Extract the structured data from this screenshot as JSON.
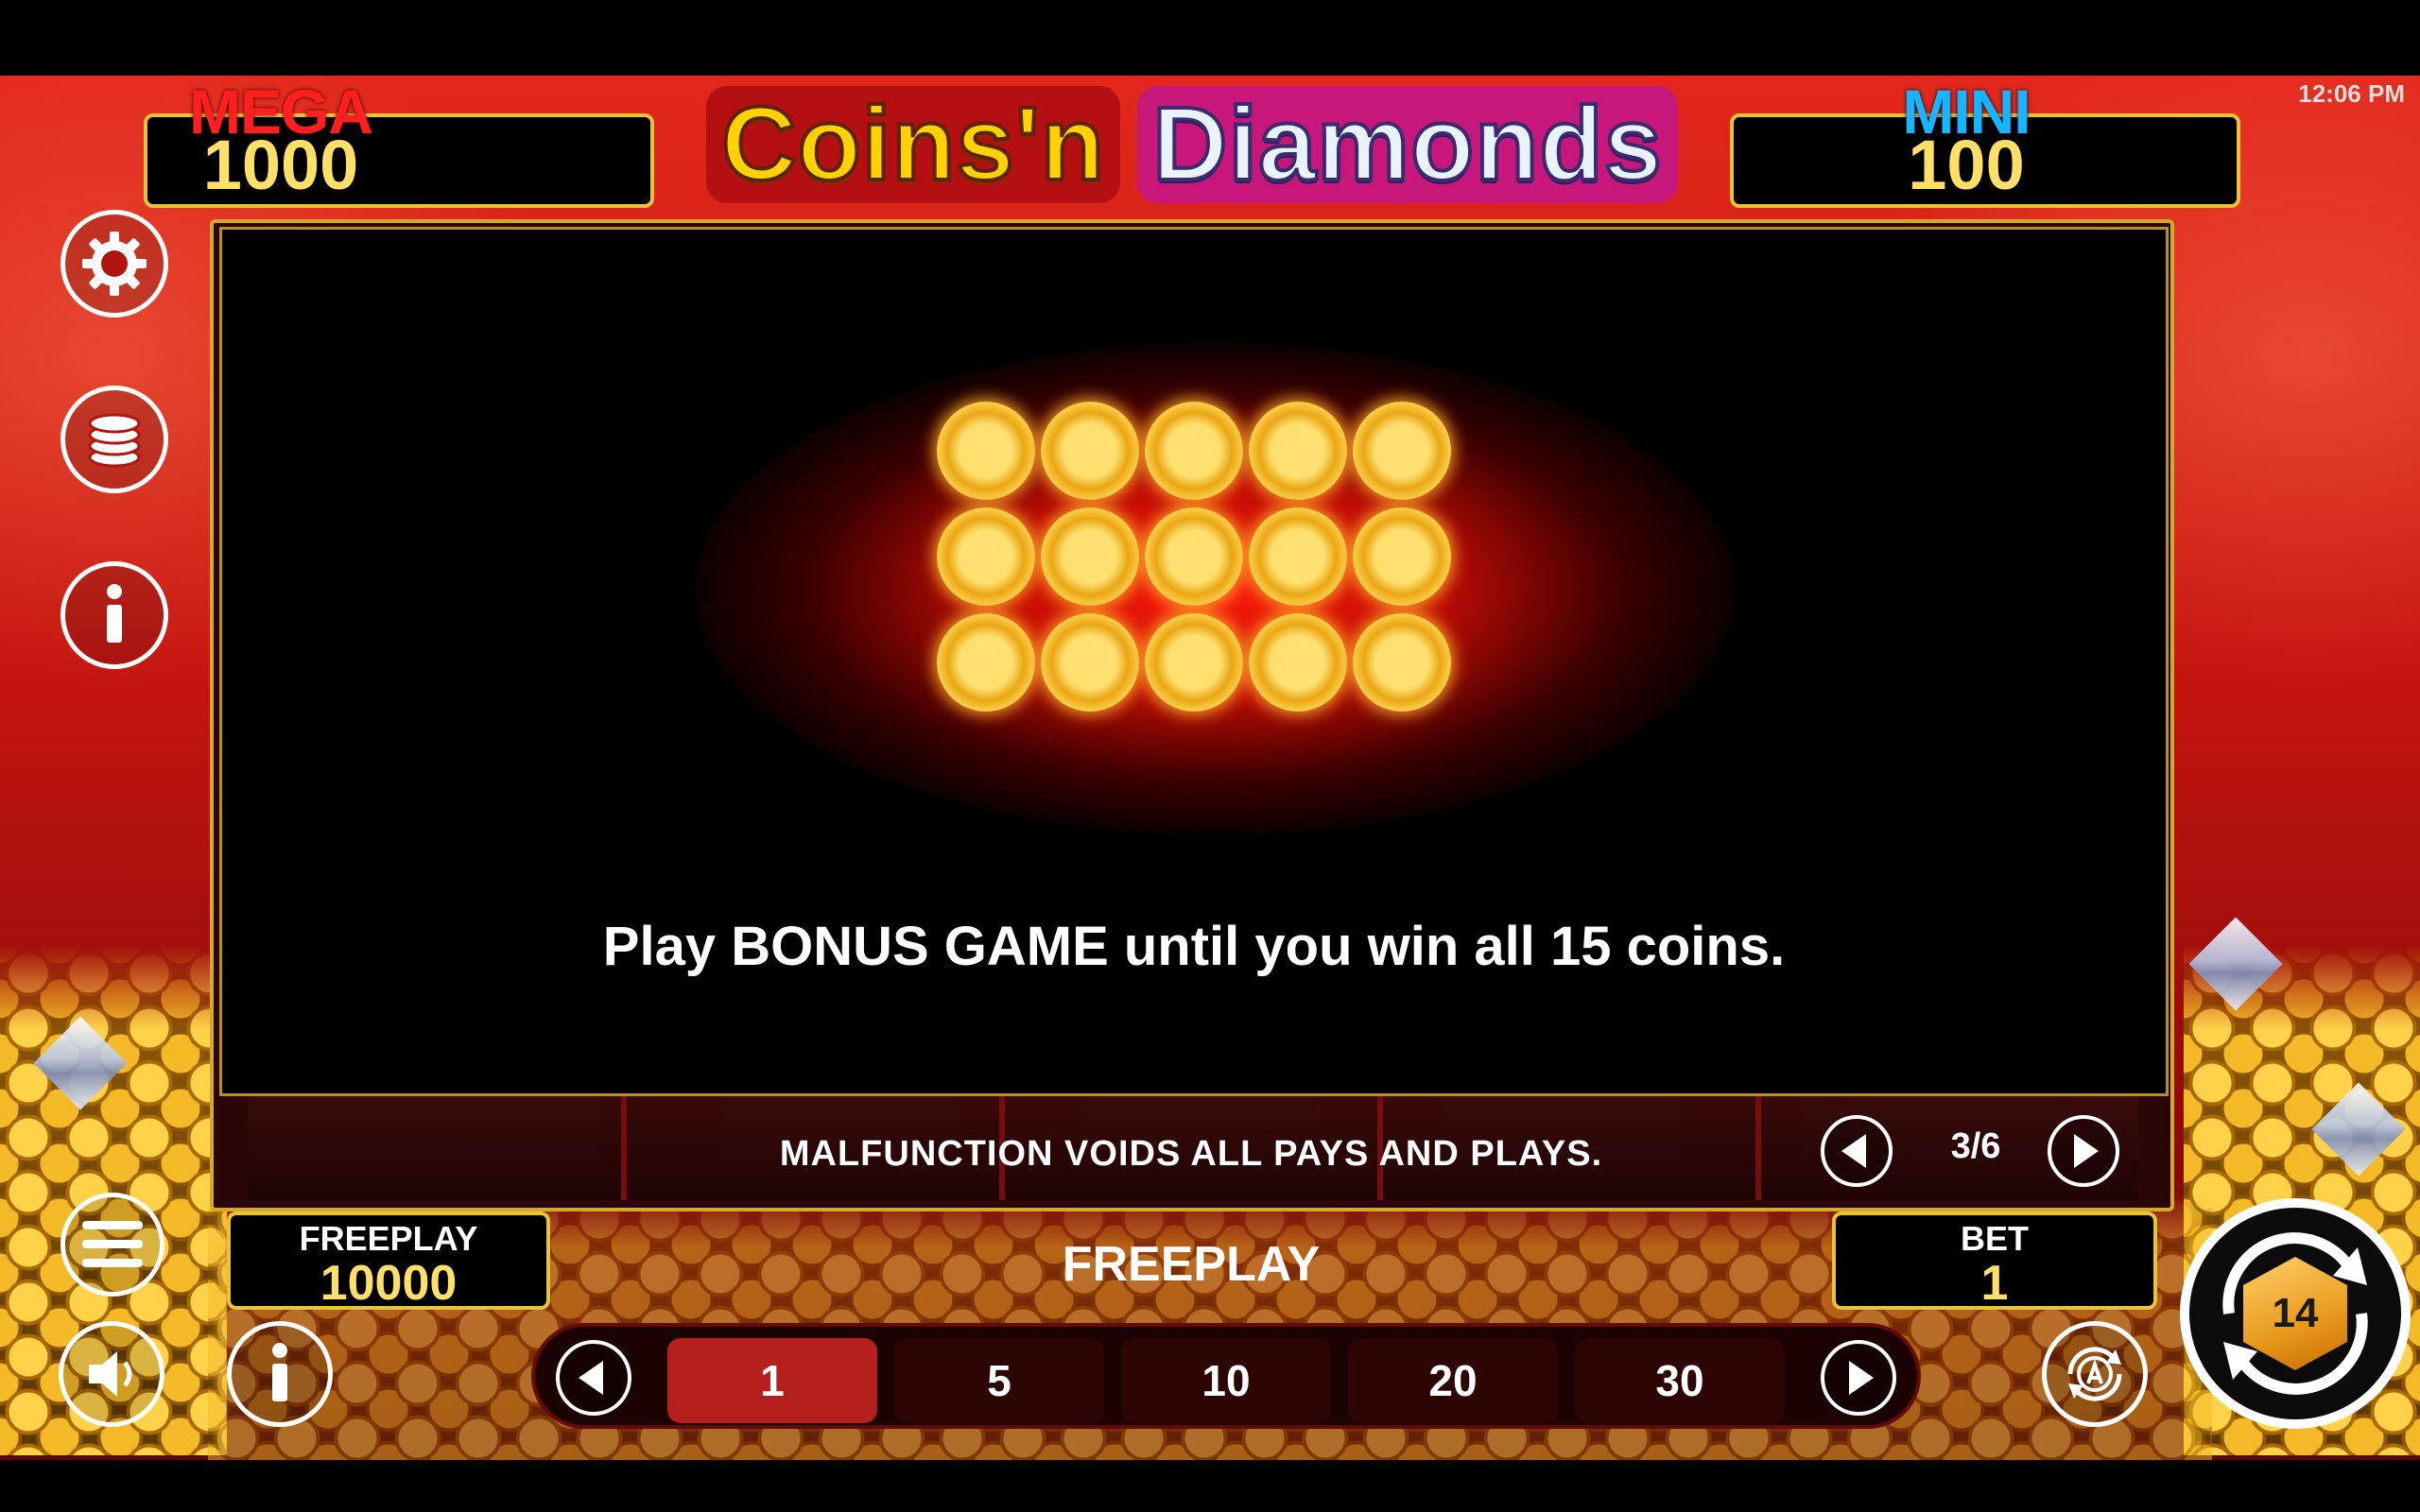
{
  "status_bar": {
    "clock": "12:06 PM"
  },
  "jackpots": {
    "mega": {
      "label": "MEGA",
      "value": "1000"
    },
    "mini": {
      "label": "MINI",
      "value": "100"
    }
  },
  "title": {
    "part1": "Coins'n",
    "part2": "Diamonds"
  },
  "info": {
    "message": "Play BONUS GAME until you win all 15 coins.",
    "disclaimer": "MALFUNCTION VOIDS ALL PAYS AND PLAYS.",
    "page": "3/6",
    "coins_shown": 15
  },
  "balance": {
    "label": "FREEPLAY",
    "value": "10000"
  },
  "mode_label": "FREEPLAY",
  "bet": {
    "label": "BET",
    "value": "1"
  },
  "bet_options": [
    "1",
    "5",
    "10",
    "20",
    "30"
  ],
  "selected_bet": "1",
  "icons": {
    "settings": "gear-icon",
    "coins": "coin-stack-icon",
    "info": "info-icon",
    "menu": "hamburger-icon",
    "sound": "speaker-icon",
    "autoplay": "autoplay-icon",
    "spin": "spin-icon"
  },
  "colors": {
    "accent_gold": "#e8c33a",
    "mega_red": "#ff1f1f",
    "mini_blue": "#16b5ff",
    "selected_bet": "#b5201c"
  }
}
